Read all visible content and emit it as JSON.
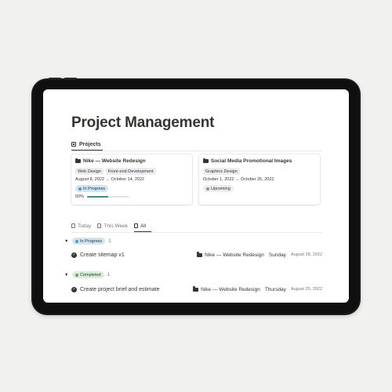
{
  "page": {
    "title": "Project Management"
  },
  "view_tab": {
    "label": "Projects",
    "icon": "gallery-icon"
  },
  "cards": [
    {
      "title": "Nike — Website Redesign",
      "icon": "folder-icon",
      "tags": [
        "Web Design",
        "Front-end Development"
      ],
      "dates": "August 8, 2022 → October 14, 2022",
      "status": "In Progress",
      "progress_label": "50%",
      "progress": 0.5
    },
    {
      "title": "Social Media Promotional Images",
      "icon": "folder-icon",
      "tags": [
        "Graphics Design"
      ],
      "dates": "October 1, 2022 → October 25, 2022",
      "status": "Upcoming"
    }
  ],
  "task_tabs": [
    {
      "label": "Today",
      "icon": "calendar-icon"
    },
    {
      "label": "This Week",
      "icon": "calendar-icon"
    },
    {
      "label": "All",
      "icon": "list-icon",
      "active": true
    }
  ],
  "groups": [
    {
      "status": "In Progress",
      "count": "1",
      "tasks": [
        {
          "name": "Create sitemap v1",
          "project": "Nike — Website Redesign",
          "day": "Sunday",
          "date": "August 28, 2022"
        }
      ]
    },
    {
      "status": "Completed",
      "count": "1",
      "tasks": [
        {
          "name": "Create project brief and estimate",
          "project": "Nike — Website Redesign",
          "day": "Thursday",
          "date": "August 25, 2022"
        }
      ]
    }
  ],
  "colors": {
    "background": "#f1f1ef",
    "tablet_bezel": "#1b1b1b",
    "text": "#37352f",
    "in_progress_bg": "#d3e5ef",
    "completed_bg": "#dbeddb",
    "progress_fill": "#4a8c6f"
  }
}
